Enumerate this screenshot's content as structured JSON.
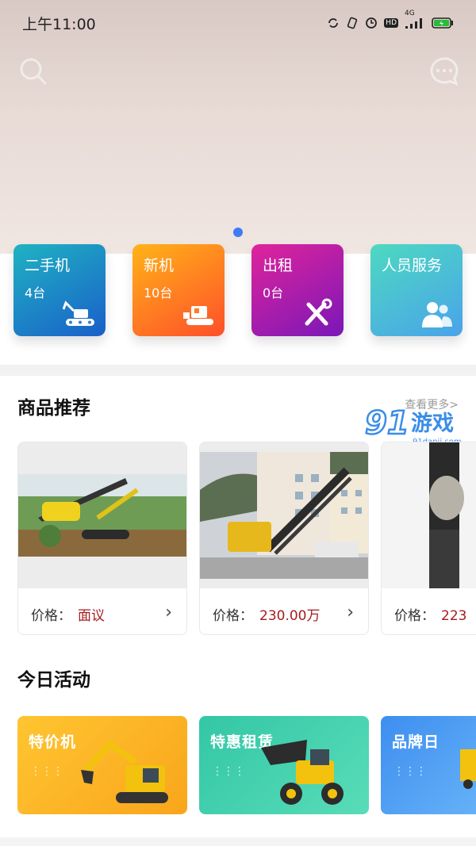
{
  "status_bar": {
    "time": "上午11:00",
    "network": "4G",
    "hd": "HD"
  },
  "categories": [
    {
      "title": "二手机",
      "count": "4台",
      "icon": "excavator-icon",
      "color_from": "#1fb3c2",
      "color_to": "#1a5fc9"
    },
    {
      "title": "新机",
      "count": "10台",
      "icon": "loader-icon",
      "color_from": "#ff9a1a",
      "color_to": "#ff4f2a"
    },
    {
      "title": "出租",
      "count": "0台",
      "icon": "tools-icon",
      "color_from": "#e0249b",
      "color_to": "#7a17b8"
    },
    {
      "title": "人员服务",
      "count": "",
      "icon": "people-icon",
      "color_from": "#4dd9c0",
      "color_to": "#4aa3ea"
    }
  ],
  "products_section": {
    "title": "商品推荐",
    "more": "查看更多>",
    "watermark": "91游戏",
    "watermark_url": "91danji.com",
    "items": [
      {
        "price_label": "价格：",
        "price_value": "面议"
      },
      {
        "price_label": "价格：",
        "price_value": "230.00万"
      },
      {
        "price_label": "价格：",
        "price_value": "223"
      }
    ]
  },
  "activities_section": {
    "title": "今日活动",
    "items": [
      {
        "label": "特价机",
        "color_from": "#ffc531",
        "color_to": "#f9a51b"
      },
      {
        "label": "特惠租赁",
        "color_from": "#33c7a6",
        "color_to": "#59dcb8"
      },
      {
        "label": "品牌日",
        "color_from": "#3d8ef0",
        "color_to": "#65b1f7"
      }
    ]
  }
}
